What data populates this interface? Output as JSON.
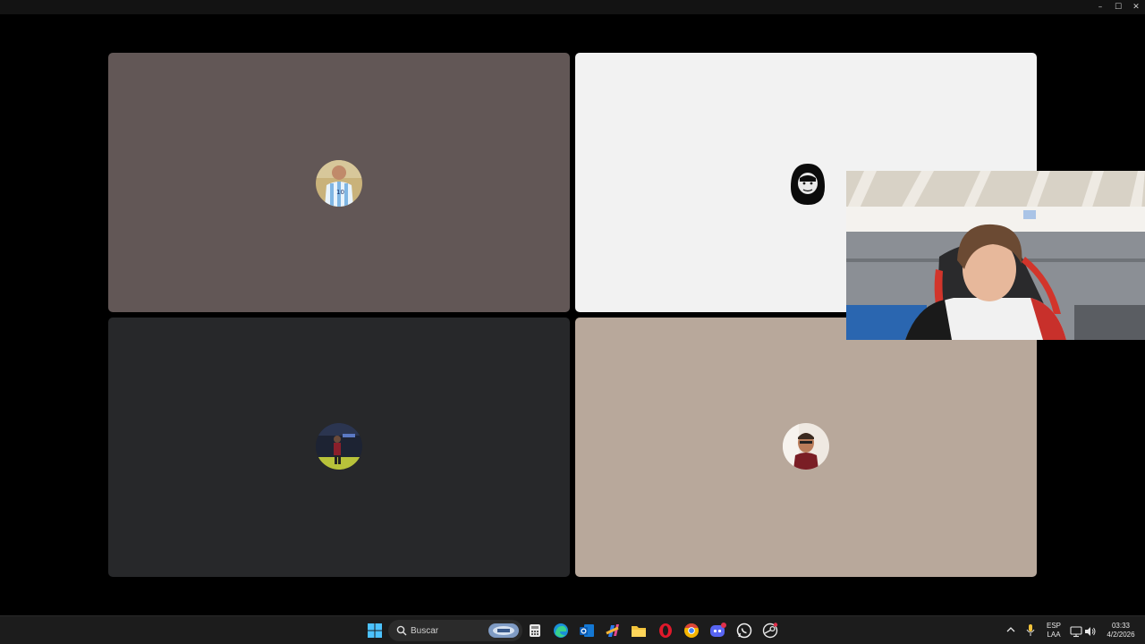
{
  "window": {
    "controls": {
      "minimize": "–",
      "maximize": "☐",
      "close": "✕"
    }
  },
  "colors": {
    "tile_1": "#625756",
    "tile_2": "#f2f2f2",
    "tile_3": "#27282a",
    "tile_4": "#b8a89b",
    "taskbar": "#1c1c1c"
  },
  "participants": [
    {
      "avatar": "argentina-jersey-avatar"
    },
    {
      "avatar": "hooded-face-avatar"
    },
    {
      "avatar": "stadium-player-avatar"
    },
    {
      "avatar": "man-portrait-avatar"
    }
  ],
  "taskbar": {
    "search": {
      "placeholder": "Buscar"
    },
    "apps": [
      "windows-start-icon",
      "search-icon",
      "widget-icon",
      "calculator-icon",
      "edge-icon",
      "outlook-icon",
      "copilot-icon",
      "file-explorer-icon",
      "opera-icon",
      "chrome-icon",
      "discord-icon",
      "whatsapp-icon",
      "steam-icon"
    ],
    "tray": {
      "language": "ESP",
      "layout": "LAA",
      "time": "03:33",
      "date": "4/2/2026"
    }
  }
}
